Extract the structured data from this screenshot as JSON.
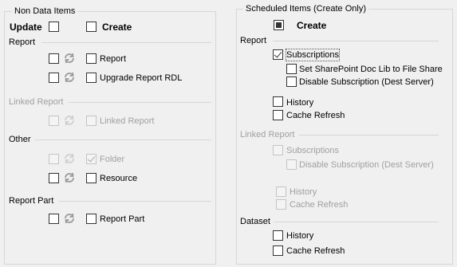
{
  "non_data": {
    "title": "Non Data Items",
    "update_label": "Update",
    "create_label": "Create",
    "sections": {
      "report": {
        "label": "Report",
        "items": [
          "Report",
          "Upgrade Report RDL"
        ]
      },
      "linked_report": {
        "label": "Linked Report",
        "items": [
          "Linked Report"
        ]
      },
      "other": {
        "label": "Other",
        "items": [
          "Folder",
          "Resource"
        ]
      },
      "report_part": {
        "label": "Report Part",
        "items": [
          "Report Part"
        ]
      }
    }
  },
  "scheduled": {
    "title": "Scheduled Items (Create Only)",
    "create_label": "Create",
    "sections": {
      "report": {
        "label": "Report",
        "subscriptions": "Subscriptions",
        "set_sharepoint": "Set SharePoint Doc Lib to File Share",
        "disable_sub": "Disable Subscription (Dest Server)",
        "history": "History",
        "cache_refresh": "Cache Refresh"
      },
      "linked_report": {
        "label": "Linked Report",
        "subscriptions": "Subscriptions",
        "disable_sub": "Disable Subscription (Dest Server)",
        "history": "History",
        "cache_refresh": "Cache Refresh"
      },
      "dataset": {
        "label": "Dataset",
        "history": "History",
        "cache_refresh": "Cache Refresh"
      }
    }
  },
  "icons": {
    "refresh": "refresh-icon"
  },
  "colors": {
    "background": "#f0f0f0",
    "group_border": "#d6d6d6",
    "disabled_text": "#a0a0a0",
    "icon_gray": "#9a9a9a"
  }
}
